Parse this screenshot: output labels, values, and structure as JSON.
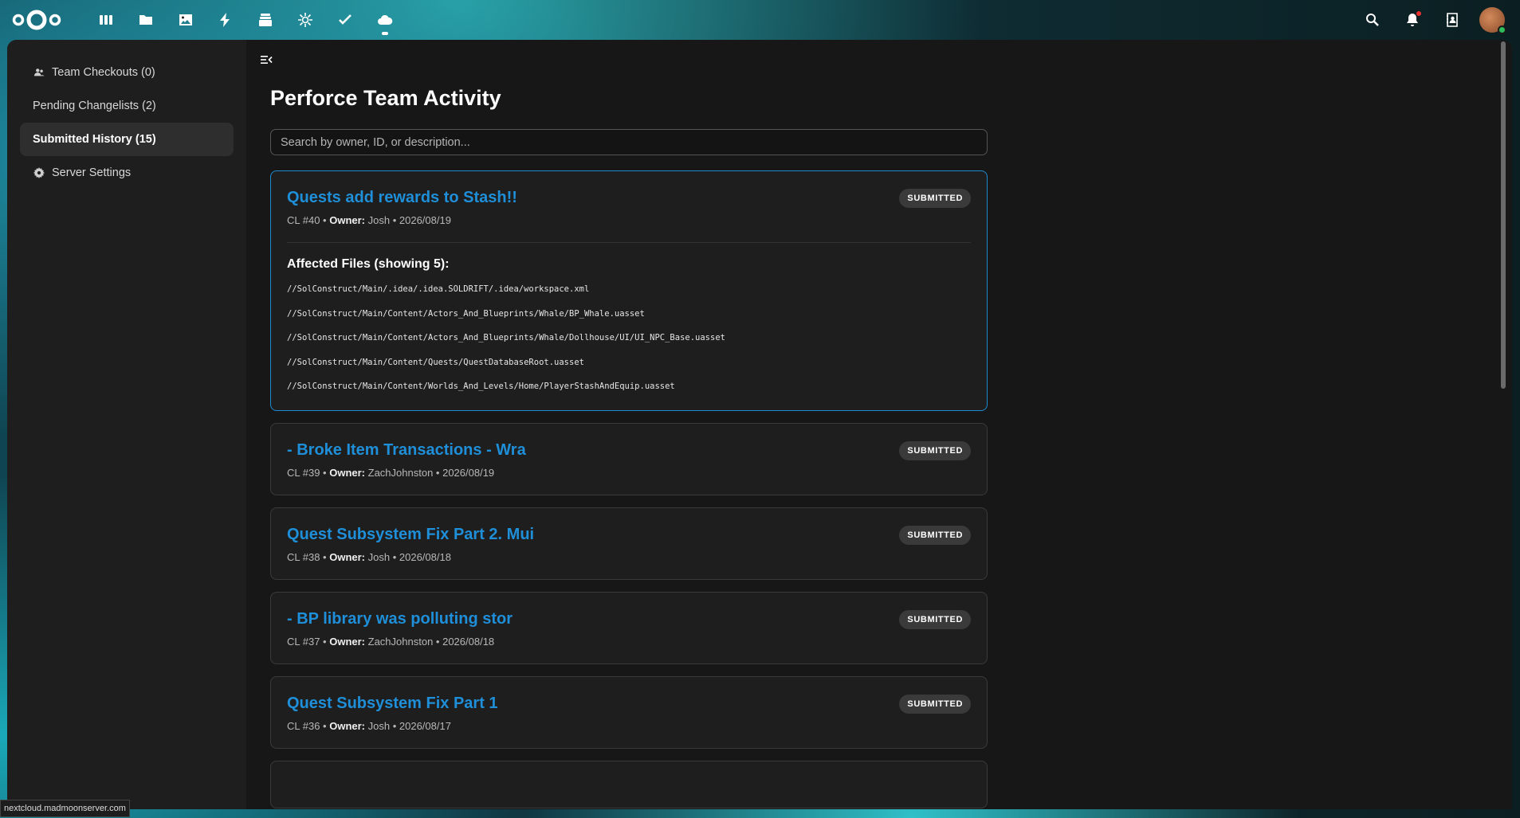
{
  "header": {
    "apps": [
      {
        "name": "dashboard-icon"
      },
      {
        "name": "files-icon"
      },
      {
        "name": "photos-icon"
      },
      {
        "name": "activity-icon"
      },
      {
        "name": "deck-icon"
      },
      {
        "name": "perforce-icon"
      },
      {
        "name": "tasks-icon"
      },
      {
        "name": "cloud-icon"
      }
    ],
    "active_app": "cloud-icon"
  },
  "sidebar": {
    "items": [
      {
        "label": "Team Checkouts (0)",
        "icon": "team-icon",
        "active": false
      },
      {
        "label": "Pending Changelists (2)",
        "icon": "",
        "active": false
      },
      {
        "label": "Submitted History (15)",
        "icon": "",
        "active": true
      },
      {
        "label": "Server Settings",
        "icon": "gear-icon",
        "active": false
      }
    ]
  },
  "main": {
    "title": "Perforce Team Activity",
    "search_placeholder": "Search by owner, ID, or description..."
  },
  "changelists": [
    {
      "title": "Quests add rewards to Stash!!",
      "cl": "CL #40",
      "owner_label": "Owner:",
      "owner": "Josh",
      "date": "2026/08/19",
      "status": "SUBMITTED",
      "expanded": true,
      "files_title": "Affected Files (showing 5):",
      "files": [
        "//SolConstruct/Main/.idea/.idea.SOLDRIFT/.idea/workspace.xml",
        "//SolConstruct/Main/Content/Actors_And_Blueprints/Whale/BP_Whale.uasset",
        "//SolConstruct/Main/Content/Actors_And_Blueprints/Whale/Dollhouse/UI/UI_NPC_Base.uasset",
        "//SolConstruct/Main/Content/Quests/QuestDatabaseRoot.uasset",
        "//SolConstruct/Main/Content/Worlds_And_Levels/Home/PlayerStashAndEquip.uasset"
      ]
    },
    {
      "title": "- Broke Item Transactions - Wra",
      "cl": "CL #39",
      "owner_label": "Owner:",
      "owner": "ZachJohnston",
      "date": "2026/08/19",
      "status": "SUBMITTED",
      "expanded": false
    },
    {
      "title": "Quest Subsystem Fix Part 2. Mui",
      "cl": "CL #38",
      "owner_label": "Owner:",
      "owner": "Josh",
      "date": "2026/08/18",
      "status": "SUBMITTED",
      "expanded": false
    },
    {
      "title": "- BP library was polluting stor",
      "cl": "CL #37",
      "owner_label": "Owner:",
      "owner": "ZachJohnston",
      "date": "2026/08/18",
      "status": "SUBMITTED",
      "expanded": false
    },
    {
      "title": "Quest Subsystem Fix Part 1",
      "cl": "CL #36",
      "owner_label": "Owner:",
      "owner": "Josh",
      "date": "2026/08/17",
      "status": "SUBMITTED",
      "expanded": false
    }
  ],
  "status_bar": {
    "url": "nextcloud.madmoonserver.com"
  }
}
